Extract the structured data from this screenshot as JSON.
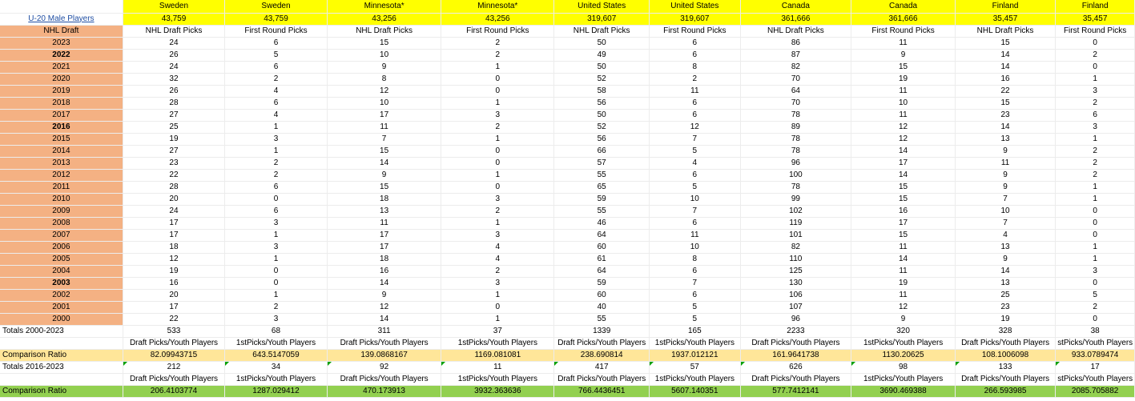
{
  "corner_label": "U-20 Male Players",
  "columns": [
    {
      "country": "Sweden",
      "population": "43,759",
      "subheader": "NHL Draft Picks"
    },
    {
      "country": "Sweden",
      "population": "43,759",
      "subheader": "First Round Picks"
    },
    {
      "country": "Minnesota*",
      "population": "43,256",
      "subheader": "NHL Draft Picks"
    },
    {
      "country": "Minnesota*",
      "population": "43,256",
      "subheader": "First Round Picks"
    },
    {
      "country": "United States",
      "population": "319,607",
      "subheader": "NHL Draft Picks"
    },
    {
      "country": "United States",
      "population": "319,607",
      "subheader": "First Round Picks"
    },
    {
      "country": "Canada",
      "population": "361,666",
      "subheader": "NHL Draft Picks"
    },
    {
      "country": "Canada",
      "population": "361,666",
      "subheader": "First Round Picks"
    },
    {
      "country": "Finland",
      "population": "35,457",
      "subheader": "NHL Draft Picks"
    },
    {
      "country": "Finland",
      "population": "35,457",
      "subheader": "First Round Picks"
    }
  ],
  "year_header": "NHL Draft",
  "rows": [
    {
      "year": "2023",
      "bold": false,
      "values": [
        "24",
        "6",
        "15",
        "2",
        "50",
        "6",
        "86",
        "11",
        "15",
        "0"
      ]
    },
    {
      "year": "2022",
      "bold": true,
      "values": [
        "26",
        "5",
        "10",
        "2",
        "49",
        "6",
        "87",
        "9",
        "14",
        "2"
      ]
    },
    {
      "year": "2021",
      "bold": false,
      "values": [
        "24",
        "6",
        "9",
        "1",
        "50",
        "8",
        "82",
        "15",
        "14",
        "0"
      ]
    },
    {
      "year": "2020",
      "bold": false,
      "values": [
        "32",
        "2",
        "8",
        "0",
        "52",
        "2",
        "70",
        "19",
        "16",
        "1"
      ]
    },
    {
      "year": "2019",
      "bold": false,
      "values": [
        "26",
        "4",
        "12",
        "0",
        "58",
        "11",
        "64",
        "11",
        "22",
        "3"
      ]
    },
    {
      "year": "2018",
      "bold": false,
      "values": [
        "28",
        "6",
        "10",
        "1",
        "56",
        "6",
        "70",
        "10",
        "15",
        "2"
      ]
    },
    {
      "year": "2017",
      "bold": false,
      "values": [
        "27",
        "4",
        "17",
        "3",
        "50",
        "6",
        "78",
        "11",
        "23",
        "6"
      ]
    },
    {
      "year": "2016",
      "bold": true,
      "values": [
        "25",
        "1",
        "11",
        "2",
        "52",
        "12",
        "89",
        "12",
        "14",
        "3"
      ]
    },
    {
      "year": "2015",
      "bold": false,
      "values": [
        "19",
        "3",
        "7",
        "1",
        "56",
        "7",
        "78",
        "12",
        "13",
        "1"
      ]
    },
    {
      "year": "2014",
      "bold": false,
      "values": [
        "27",
        "1",
        "15",
        "0",
        "66",
        "5",
        "78",
        "14",
        "9",
        "2"
      ]
    },
    {
      "year": "2013",
      "bold": false,
      "values": [
        "23",
        "2",
        "14",
        "0",
        "57",
        "4",
        "96",
        "17",
        "11",
        "2"
      ]
    },
    {
      "year": "2012",
      "bold": false,
      "values": [
        "22",
        "2",
        "9",
        "1",
        "55",
        "6",
        "100",
        "14",
        "9",
        "2"
      ]
    },
    {
      "year": "2011",
      "bold": false,
      "values": [
        "28",
        "6",
        "15",
        "0",
        "65",
        "5",
        "78",
        "15",
        "9",
        "1"
      ]
    },
    {
      "year": "2010",
      "bold": false,
      "values": [
        "20",
        "0",
        "18",
        "3",
        "59",
        "10",
        "99",
        "15",
        "7",
        "1"
      ]
    },
    {
      "year": "2009",
      "bold": false,
      "values": [
        "24",
        "6",
        "13",
        "2",
        "55",
        "7",
        "102",
        "16",
        "10",
        "0"
      ]
    },
    {
      "year": "2008",
      "bold": false,
      "values": [
        "17",
        "3",
        "11",
        "1",
        "46",
        "6",
        "119",
        "17",
        "7",
        "0"
      ]
    },
    {
      "year": "2007",
      "bold": false,
      "values": [
        "17",
        "1",
        "17",
        "3",
        "64",
        "11",
        "101",
        "15",
        "4",
        "0"
      ]
    },
    {
      "year": "2006",
      "bold": false,
      "values": [
        "18",
        "3",
        "17",
        "4",
        "60",
        "10",
        "82",
        "11",
        "13",
        "1"
      ]
    },
    {
      "year": "2005",
      "bold": false,
      "values": [
        "12",
        "1",
        "18",
        "4",
        "61",
        "8",
        "110",
        "14",
        "9",
        "1"
      ]
    },
    {
      "year": "2004",
      "bold": false,
      "values": [
        "19",
        "0",
        "16",
        "2",
        "64",
        "6",
        "125",
        "11",
        "14",
        "3"
      ]
    },
    {
      "year": "2003",
      "bold": true,
      "values": [
        "16",
        "0",
        "14",
        "3",
        "59",
        "7",
        "130",
        "19",
        "13",
        "0"
      ]
    },
    {
      "year": "2002",
      "bold": false,
      "values": [
        "20",
        "1",
        "9",
        "1",
        "60",
        "6",
        "106",
        "11",
        "25",
        "5"
      ]
    },
    {
      "year": "2001",
      "bold": false,
      "values": [
        "17",
        "2",
        "12",
        "0",
        "40",
        "5",
        "107",
        "12",
        "23",
        "2"
      ]
    },
    {
      "year": "2000",
      "bold": false,
      "values": [
        "22",
        "3",
        "14",
        "1",
        "55",
        "5",
        "96",
        "9",
        "19",
        "0"
      ]
    }
  ],
  "totals_all": {
    "label": "Totals 2000-2023",
    "values": [
      "533",
      "68",
      "311",
      "37",
      "1339",
      "165",
      "2233",
      "320",
      "328",
      "38"
    ]
  },
  "ratio_headers_1": [
    "Draft Picks/Youth Players",
    "1stPicks/Youth Players",
    "Draft Picks/Youth Players",
    "1stPicks/Youth Players",
    "Draft Picks/Youth Players",
    "1stPicks/Youth Players",
    "Draft Picks/Youth Players",
    "1stPicks/Youth Players",
    "Draft Picks/Youth Players",
    "stPicks/Youth Players"
  ],
  "ratio_1": {
    "label": "Comparison Ratio",
    "values": [
      "82.09943715",
      "643.5147059",
      "139.0868167",
      "1169.081081",
      "238.690814",
      "1937.012121",
      "161.9641738",
      "1130.20625",
      "108.1006098",
      "933.0789474"
    ]
  },
  "totals_recent": {
    "label": "Totals 2016-2023",
    "values": [
      "212",
      "34",
      "92",
      "11",
      "417",
      "57",
      "626",
      "98",
      "133",
      "17"
    ]
  },
  "ratio_headers_2": [
    "Draft Picks/Youth Players",
    "1stPicks/Youth Players",
    "Draft Picks/Youth Players",
    "1stPicks/Youth Players",
    "Draft Picks/Youth Players",
    "1stPicks/Youth Players",
    "Draft Picks/Youth Players",
    "1stPicks/Youth Players",
    "Draft Picks/Youth Players",
    "stPicks/Youth Players"
  ],
  "ratio_2": {
    "label": "Comparison Ratio",
    "values": [
      "206.4103774",
      "1287.029412",
      "470.173913",
      "3932.363636",
      "766.4436451",
      "5607.140351",
      "577.7412141",
      "3690.469388",
      "266.593985",
      "2085.705882"
    ]
  },
  "colors": {
    "header_yellow": "#ffff00",
    "year_column_orange": "#f4b183",
    "ratio1_row": "#ffe699",
    "ratio2_row": "#92d050",
    "link_blue": "#1f4ea3"
  }
}
